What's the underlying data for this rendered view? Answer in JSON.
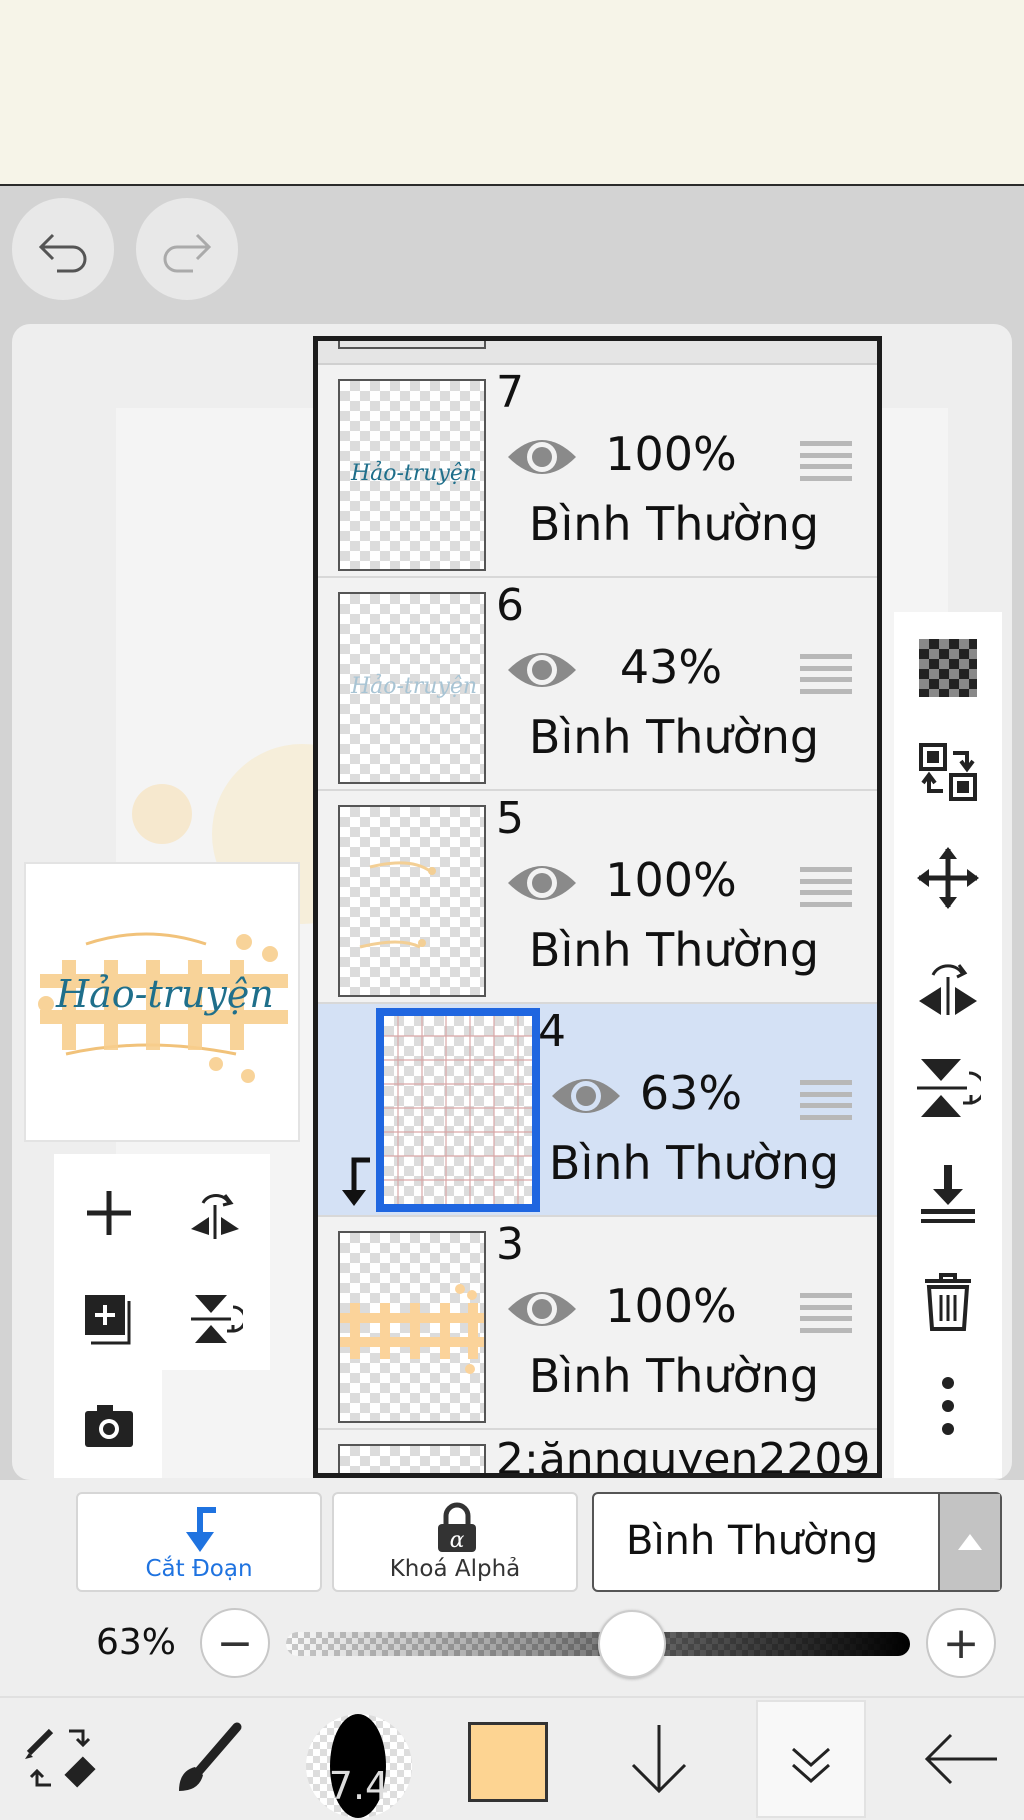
{
  "layers": [
    {
      "num": "7",
      "opacity": "100%",
      "mode": "Bình Thường",
      "thumb_text": "Hảo-truyện",
      "selected": false
    },
    {
      "num": "6",
      "opacity": "43%",
      "mode": "Bình Thường",
      "thumb_text": "Hảo-truyện",
      "selected": false
    },
    {
      "num": "5",
      "opacity": "100%",
      "mode": "Bình Thường",
      "selected": false
    },
    {
      "num": "4",
      "opacity": "63%",
      "mode": "Bình Thường",
      "selected": true
    },
    {
      "num": "3",
      "opacity": "100%",
      "mode": "Bình Thường",
      "selected": false
    }
  ],
  "partial_layer": {
    "label": "2:ănnguyen2209"
  },
  "preview": {
    "title": "Hảo-truyện"
  },
  "options": {
    "clip_label": "Cắt Đoạn",
    "alpha_label": "Khoá Alphả",
    "blend_mode": "Bình Thường"
  },
  "opacity": {
    "label": "63%",
    "value": 0.63,
    "minus": "−",
    "plus": "+"
  },
  "brush": {
    "size": "7.4"
  },
  "colors": {
    "accent": "#1f66e0",
    "selected_row": "#d4e1f5",
    "current_color": "#fdd492"
  },
  "icons": {
    "undo": "undo-icon",
    "redo": "redo-icon",
    "add": "plus-icon",
    "flip_h": "flip-horizontal-icon",
    "add_copy": "add-layer-icon",
    "flip_v": "flip-vertical-icon",
    "camera": "camera-icon",
    "checker": "transparency-icon",
    "swap": "swap-icon",
    "move": "move-icon",
    "merge": "merge-down-icon",
    "trash": "trash-icon",
    "more": "more-vertical-icon"
  }
}
